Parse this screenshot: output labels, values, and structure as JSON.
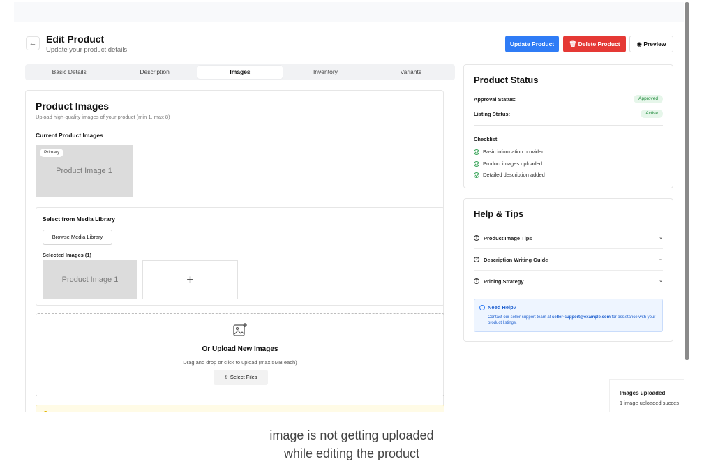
{
  "header": {
    "title": "Edit Product",
    "subtitle": "Update your product details",
    "update_label": "Update Product",
    "delete_label": "Delete Product",
    "preview_label": "Preview"
  },
  "tabs": [
    {
      "label": "Basic Details",
      "active": false
    },
    {
      "label": "Description",
      "active": false
    },
    {
      "label": "Images",
      "active": true
    },
    {
      "label": "Inventory",
      "active": false
    },
    {
      "label": "Variants",
      "active": false
    }
  ],
  "images": {
    "title": "Product Images",
    "description": "Upload high-quality images of your product (min 1, max 8)",
    "current_label": "Current Product Images",
    "primary_badge": "Primary",
    "current_image_text": "Product Image 1"
  },
  "media_library": {
    "title": "Select from Media Library",
    "browse_label": "Browse Media Library",
    "selected_label": "Selected Images (1)",
    "selected_image_text": "Product Image 1",
    "add_symbol": "+"
  },
  "upload": {
    "title": "Or Upload New Images",
    "hint": "Drag and drop or click to upload (max 5MB each)",
    "button_label": "Select Files"
  },
  "status": {
    "title": "Product Status",
    "approval_label": "Approval Status:",
    "approval_value": "Approved",
    "listing_label": "Listing Status:",
    "listing_value": "Active",
    "checklist_label": "Checklist",
    "checklist": [
      "Basic information provided",
      "Product images uploaded",
      "Detailed description added"
    ]
  },
  "help": {
    "title": "Help & Tips",
    "items": [
      "Product Image Tips",
      "Description Writing Guide",
      "Pricing Strategy"
    ],
    "need_help_title": "Need Help?",
    "need_help_text_before": "Contact our seller support team at ",
    "need_help_email": "seller-support@example.com",
    "need_help_text_after": " for assistance with your product listings."
  },
  "toast": {
    "title": "Images uploaded",
    "message": "1 image uploaded succes"
  },
  "caption": {
    "line1": "image is not getting uploaded",
    "line2": "while editing the product"
  },
  "colors": {
    "primary": "#2f7cf6",
    "danger": "#e53935",
    "success": "#1f8a3a"
  }
}
